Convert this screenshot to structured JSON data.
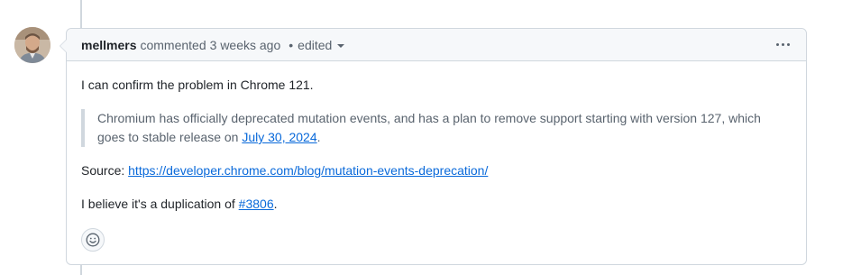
{
  "comment": {
    "author": "mellmers",
    "action": "commented",
    "time": "3 weeks ago",
    "separator": "•",
    "edited_label": "edited",
    "body": {
      "p1": "I can confirm the problem in Chrome 121.",
      "quote_text": "Chromium has officially deprecated mutation events, and has a plan to remove support starting with version 127, which goes to stable release on ",
      "quote_link": "July 30, 2024",
      "quote_end": ".",
      "source_label": "Source: ",
      "source_link": "https://developer.chrome.com/blog/mutation-events-deprecation/",
      "dup_text": "I believe it's a duplication of ",
      "dup_link": "#3806",
      "dup_end": "."
    }
  },
  "icons": {
    "more": "kebab-horizontal-icon",
    "reaction": "smiley-icon"
  },
  "colors": {
    "link": "#0969da",
    "border": "#d0d7de",
    "header_bg": "#f6f8fa",
    "muted": "#59636e"
  }
}
